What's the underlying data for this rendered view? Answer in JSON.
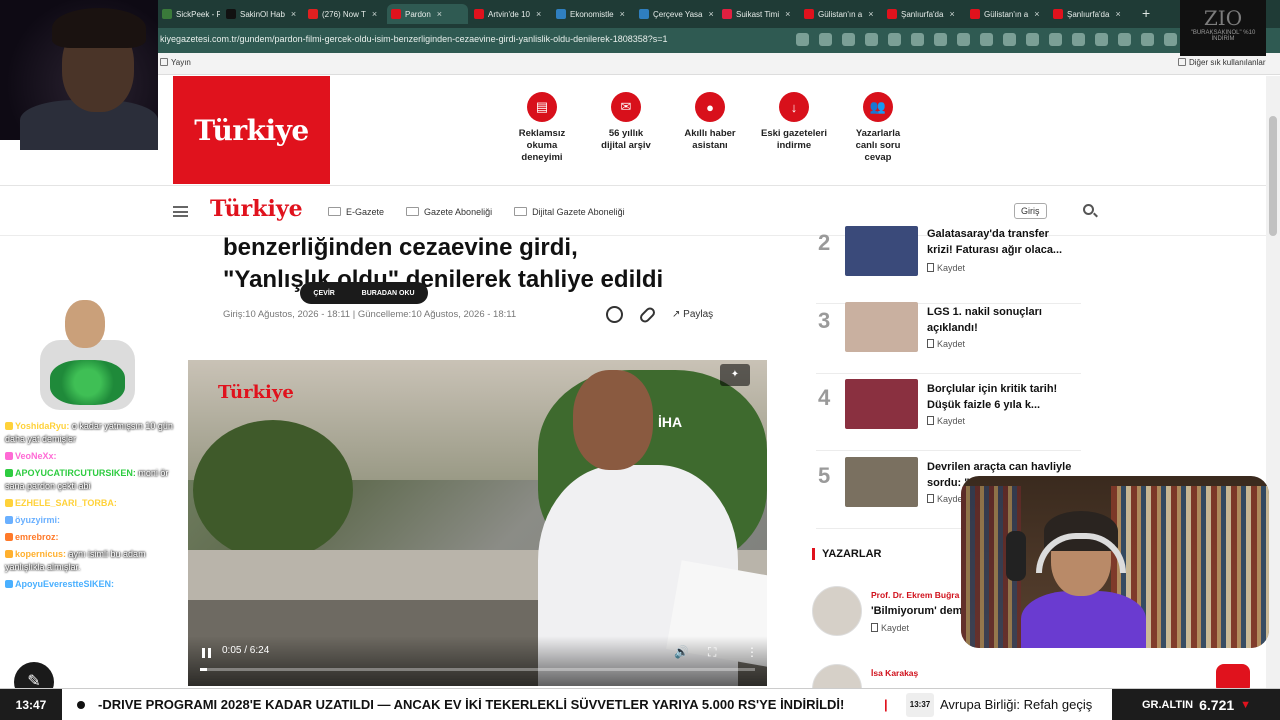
{
  "browser": {
    "tabs": [
      {
        "label": "SickPeek - R",
        "color": "#3a7a3a"
      },
      {
        "label": "SakinOl Hab",
        "color": "#111111"
      },
      {
        "label": "(276) Now T",
        "color": "#e02020"
      },
      {
        "label": "Pardon",
        "color": "#e0121d"
      },
      {
        "label": "Artvin'de 10",
        "color": "#e0121d"
      },
      {
        "label": "Ekonomistle",
        "color": "#2f7fbf"
      },
      {
        "label": "Çerçeve Yasa",
        "color": "#2f7fbf"
      },
      {
        "label": "Suikast Timi",
        "color": "#e02040"
      },
      {
        "label": "Gülistan'ın a",
        "color": "#e0121d"
      },
      {
        "label": "Şanlıurfa'da",
        "color": "#e0121d"
      },
      {
        "label": "Gülistan'ın a",
        "color": "#e0121d"
      },
      {
        "label": "Şanlıurfa'da",
        "color": "#e0121d"
      }
    ],
    "url": "kiyegazetesi.com.tr/gundem/pardon-filmi-gercek-oldu-isim-benzerliginden-cezaevine-girdi-yanlislik-oldu-denilerek-1808358?s=1",
    "bookmark_left": "Yayın",
    "bookmark_right": "Diğer sık kullanılanlar"
  },
  "header": {
    "logo_text": "Türkiye",
    "features": [
      {
        "label": "Reklamsız\nokuma\ndeneyimi",
        "icon": "layout-icon"
      },
      {
        "label": "56 yıllık\ndijital arşiv",
        "icon": "archive-icon"
      },
      {
        "label": "Akıllı haber\nasistanı",
        "icon": "chat-icon"
      },
      {
        "label": "Eski gazeteleri\nindirme",
        "icon": "download-icon"
      },
      {
        "label": "Yazarlarla\ncanlı soru\ncevap",
        "icon": "users-icon"
      }
    ]
  },
  "nav": {
    "logo_text": "Türkiye",
    "links": [
      "E-Gazete",
      "Gazete Aboneliği",
      "Dijital Gazete Aboneliği"
    ],
    "login": "Giriş"
  },
  "article": {
    "headline_line1": "benzerliğinden cezaevine girdi,",
    "headline_line2": "\"Yanlışlık oldu\" denilerek tahliye edildi",
    "meta_published": "Giriş:10 Ağustos, 2026 - 18:11",
    "meta_separator": "|",
    "meta_updated": "Güncelleme:10 Ağustos, 2026 - 18:11",
    "share_label": "Paylaş",
    "translate_pill": {
      "left": "ÇEVİR",
      "right": "BURADAN OKU"
    }
  },
  "video": {
    "watermark_logo": "Türkiye",
    "watermark_agency": "İHA",
    "time": "0:05 / 6:24",
    "progress": 0.013
  },
  "sidebar": {
    "items": [
      {
        "num": "2",
        "title": "Galatasaray'da transfer krizi! Faturası ağır olaca...",
        "save": "Kaydet",
        "thumb": "#3a4a7a"
      },
      {
        "num": "3",
        "title": "LGS 1. nakil sonuçları açıklandı!",
        "save": "Kaydet",
        "thumb": "#c9b0a0"
      },
      {
        "num": "4",
        "title": "Borçlular için kritik tarih! Düşük faizle 6 yıla k...",
        "save": "Kaydet",
        "thumb": "#8a3040"
      },
      {
        "num": "5",
        "title": "Devrilen araçta can havliyle sordu: \"B...",
        "save": "Kaydet",
        "thumb": "#7a7060"
      }
    ],
    "yazarlar_heading": "YAZARLAR",
    "authors": [
      {
        "name": "Prof. Dr. Ekrem Buğra",
        "title": "'Bilmiyorum' dem",
        "save": "Kaydet"
      },
      {
        "name": "İsa Karakaş",
        "title": "",
        "save": ""
      }
    ]
  },
  "chat": [
    {
      "user": "YoshidaRyu:",
      "text": "o kadar yatmışsın 10 gün daha yat demişler",
      "color": "#ffd23a"
    },
    {
      "user": "VeoNeXx:",
      "text": "",
      "color": "#ff6ad5"
    },
    {
      "user": "APOYUCATIRCUTURSIKEN:",
      "text": "moni ör sana pardon çekti abi",
      "color": "#2ecc40"
    },
    {
      "user": "EZHELE_SARI_TORBA:",
      "text": "",
      "color": "#ffd23a"
    },
    {
      "user": "öyuzyirmi:",
      "text": "",
      "color": "#6ab0ff"
    },
    {
      "user": "emrebroz:",
      "text": "",
      "color": "#ff7a2a"
    },
    {
      "user": "kopernicus:",
      "text": "aynı isimli bu adam yanlışlıkla almışlar.",
      "color": "#ffb02e"
    },
    {
      "user": "ApoyuEverestteSIKEN:",
      "text": "",
      "color": "#4ab0ff"
    }
  ],
  "brand_overlay": {
    "logo": "ZIO",
    "sub": "\"BURAKSAKINOL\" %10 İNDİRİM"
  },
  "ticker": {
    "time": "13:47",
    "text": "-DRIVE PROGRAMI 2028'E KADAR UZATILDI — ANCAK EV İKİ TEKERLEKLİ SÜVVETLER YARIYA 5.000 RS'YE İNDİRİLDİ!",
    "separator": "|",
    "time2": "13:37",
    "text2": "Avrupa Birliği: Refah geçiş",
    "gold_label": "GR.ALTIN",
    "gold_value": "6.721",
    "gold_arrow": "▼"
  }
}
